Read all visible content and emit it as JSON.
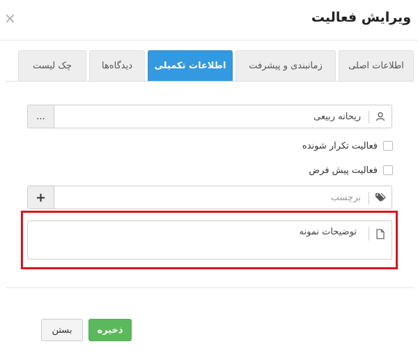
{
  "modal": {
    "title": "ویرایش فعالیت",
    "close_label": "×"
  },
  "tabs": [
    {
      "label": "اطلاعات اصلی",
      "active": false
    },
    {
      "label": "زمانبندی و پیشرفت",
      "active": false
    },
    {
      "label": "اطلاعات تکمیلی",
      "active": true
    },
    {
      "label": "دیدگاه‌ها",
      "active": false
    },
    {
      "label": "چک لیست",
      "active": false
    }
  ],
  "assignee": {
    "value": "ریحانه ربیعی",
    "addon_label": "...",
    "icon": "user-icon"
  },
  "checkboxes": {
    "recurring": {
      "label": "فعالیت تکرار شونده",
      "checked": false
    },
    "default": {
      "label": "فعالیت پیش فرض",
      "checked": false
    }
  },
  "tag": {
    "placeholder": "برچسب",
    "addon_label": "+",
    "icon": "tag-icon"
  },
  "description": {
    "value": "توضیحات نمونه",
    "icon": "file-icon"
  },
  "footer": {
    "save_label": "ذخیره",
    "close_label": "بستن"
  },
  "colors": {
    "active_tab": "#3399e0",
    "save_button": "#5cb85c",
    "highlight": "#e0101a"
  }
}
